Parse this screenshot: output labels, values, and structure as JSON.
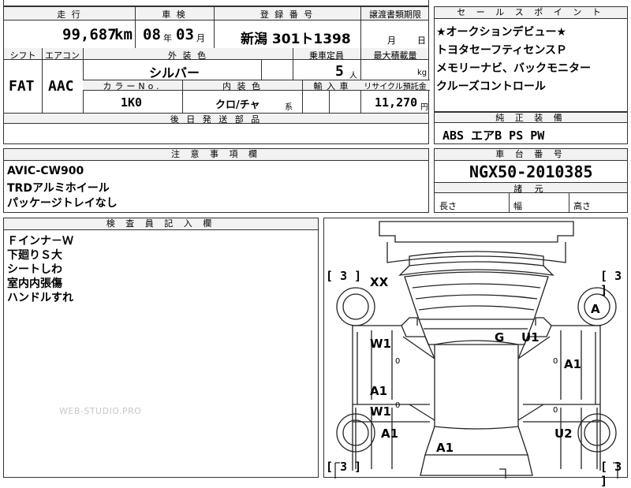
{
  "top_table": {
    "headers": {
      "mileage": "走 行",
      "inspection": "車 検",
      "registration": "登 録 番 号",
      "transfer_deadline": "譲渡書類期限",
      "shift": "シフト",
      "aircon": "エアコン",
      "exterior_color": "外 装 色",
      "capacity": "乗車定員",
      "max_load": "最大積載量",
      "color_no": "カラーNo.",
      "interior_color": "内 装 色",
      "import": "輸 入 車",
      "recycle_fee": "リサイクル預託金",
      "later_parts": "後 日 発 送 部 品"
    },
    "values": {
      "mileage_value": "99,687",
      "mileage_unit": "km",
      "inspection_year": "08",
      "inspection_year_unit": "年",
      "inspection_month": "03",
      "inspection_month_unit": "月",
      "registration_number": "新潟 301ト1398",
      "transfer_month_unit": "月",
      "transfer_day_unit": "日",
      "shift": "FAT",
      "aircon": "AAC",
      "exterior_color": "シルバー",
      "capacity": "5",
      "capacity_unit": "人",
      "max_load_unit": "kg",
      "color_no": "1K0",
      "interior_color": "クロ/チャ",
      "interior_color_suffix": "系",
      "recycle_fee": "11,270",
      "recycle_fee_unit": "円"
    }
  },
  "sales_points": {
    "header": "セ ー ル ス ポ イ ン ト",
    "lines": [
      "★オークションデビュー★",
      "トヨタセーフティセンスＰ",
      "メモリーナビ、バックモニター",
      "クルーズコントロール"
    ]
  },
  "standard_equipment": {
    "header": "純 正 装 備",
    "value": "ABS エアB PS PW"
  },
  "notes": {
    "header": "注 意 事 項 欄",
    "lines": [
      "AVIC-CW900",
      "TRDアルミホイール",
      "パッケージトレイなし"
    ]
  },
  "chassis": {
    "header": "車 台 番 号",
    "value": "NGX50-2010385"
  },
  "dimensions": {
    "header": "諸 元",
    "length": "長さ",
    "width": "幅",
    "height": "高さ"
  },
  "inspector": {
    "header": "検 査 員 記 入 欄",
    "lines": [
      "Ｆインナ－Ｗ",
      "下廻りＳ大",
      "シートしわ",
      "室内内張傷",
      "ハンドルすれ"
    ]
  },
  "diagram": {
    "tire_left_top": "3",
    "tire_right_top": "3",
    "tire_left_bottom": "3",
    "tire_right_bottom": "3",
    "damage_marks": {
      "front_left_fender": "XX",
      "front_right_wheel": "A",
      "windshield": "G",
      "right_pillar": "U1",
      "left_front_door": "W1",
      "right_front_door": "A1",
      "left_rear_door_a": "A1",
      "left_rear_door_w": "W1",
      "left_rear_fender": "A1",
      "right_rear_fender": "U2",
      "rear": "A1"
    },
    "small_zero": "0"
  },
  "watermark": "WEB-STUDIO.PRO"
}
